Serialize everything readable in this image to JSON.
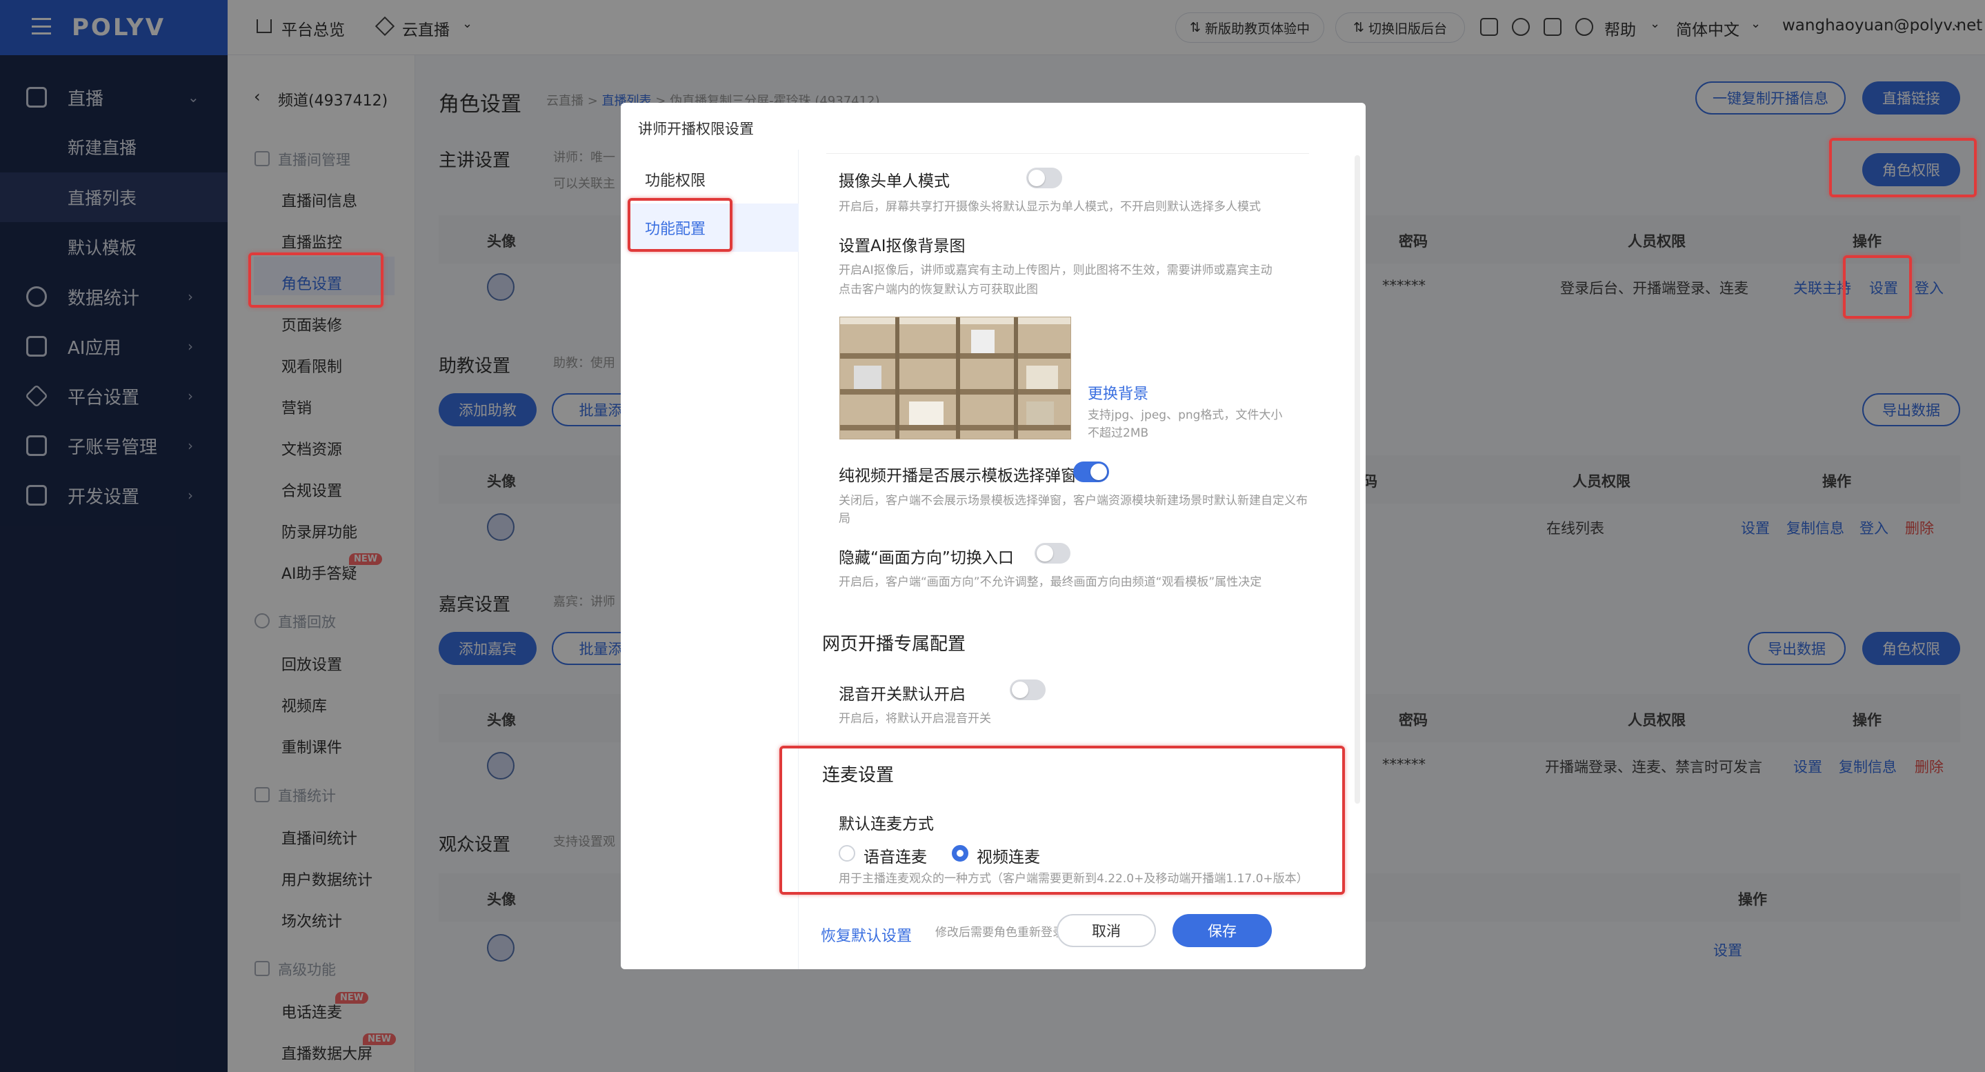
{
  "app": {
    "brand": "POLYV"
  },
  "nav": {
    "items": [
      {
        "label": "直播",
        "icon": "video-icon",
        "chevron": "⌄"
      },
      {
        "label": "新建直播"
      },
      {
        "label": "直播列表"
      },
      {
        "label": "默认模板"
      },
      {
        "label": "数据统计",
        "icon": "chart-icon",
        "chevron": "›"
      },
      {
        "label": "AI应用",
        "icon": "ai-icon",
        "chevron": "›"
      },
      {
        "label": "平台设置",
        "icon": "layers-icon",
        "chevron": "›"
      },
      {
        "label": "子账号管理",
        "icon": "id-card-icon",
        "chevron": "›"
      },
      {
        "label": "开发设置",
        "icon": "code-icon",
        "chevron": "›"
      }
    ]
  },
  "topbar": {
    "overview": "平台总览",
    "cloud_live": "云直播",
    "assistant_trial": "新版助教页体验中",
    "switch_old": "切换旧版后台",
    "help": "帮助",
    "language": "简体中文",
    "user": "wanghaoyuan@polyv.net"
  },
  "subnav": {
    "back_label": "频道(4937412)",
    "groups": [
      {
        "title": "直播间管理",
        "items": [
          "直播间信息",
          "直播监控",
          "角色设置",
          "页面装修",
          "观看限制",
          "营销",
          "文档资源",
          "合规设置",
          "防录屏功能",
          "AI助手答疑"
        ]
      },
      {
        "title": "直播回放",
        "items": [
          "回放设置",
          "视频库",
          "重制课件"
        ]
      },
      {
        "title": "直播统计",
        "items": [
          "直播间统计",
          "用户数据统计",
          "场次统计"
        ]
      },
      {
        "title": "高级功能",
        "items": [
          "电话连麦",
          "直播数据大屏"
        ]
      }
    ],
    "new_badge": "NEW"
  },
  "main": {
    "page_title": "角色设置",
    "breadcrumb": {
      "root": "云直播 >",
      "list": "直播列表",
      "sep": ">",
      "current": "伪直播复制三分屏-霍玲珠 (4937412)"
    },
    "copy_info_button": "一键复制开播信息",
    "live_link_button": "直播链接",
    "role_permission_button": "角色权限",
    "export_button": "导出数据",
    "lecturer": {
      "title": "主讲设置",
      "hint1": "讲师：唯一",
      "hint2": "可以关联主",
      "headers": [
        "头像",
        "密码",
        "人员权限",
        "操作"
      ],
      "row": {
        "password": "******",
        "permission": "登录后台、开播端登录、连麦",
        "actions": [
          "关联主持",
          "设置",
          "登入"
        ]
      }
    },
    "assistant": {
      "title": "助教设置",
      "hint": "助教：使用",
      "add_button": "添加助教",
      "batch_button": "批量添",
      "headers": [
        "头像",
        "码",
        "人员权限",
        "操作"
      ],
      "row": {
        "permission": "在线列表",
        "actions": [
          "设置",
          "复制信息",
          "登入",
          "删除"
        ]
      }
    },
    "guest": {
      "title": "嘉宾设置",
      "hint": "嘉宾：讲师",
      "add_button": "添加嘉宾",
      "batch_button": "批量添",
      "headers": [
        "头像",
        "密码",
        "人员权限",
        "操作"
      ],
      "row": {
        "password": "******",
        "permission": "开播端登录、连麦、禁言时可发言",
        "actions": [
          "设置",
          "复制信息",
          "删除"
        ]
      }
    },
    "audience": {
      "title": "观众设置",
      "hint": "支持设置观",
      "headers": [
        "头像",
        "操作"
      ],
      "row": {
        "actions": [
          "设置"
        ]
      }
    }
  },
  "modal": {
    "title": "讲师开播权限设置",
    "tabs": [
      "功能权限",
      "功能配置"
    ],
    "camera_single": {
      "label": "摄像头单人模式",
      "desc": "开启后，屏幕共享打开摄像头将默认显示为单人模式，不开启则默认选择多人模式",
      "on": false
    },
    "ai_bg": {
      "label": "设置AI抠像背景图",
      "desc1": "开启AI抠像后，讲师或嘉宾有主动上传图片，则此图将不生效，需要讲师或嘉宾主动",
      "desc2": "点击客户端内的恢复默认方可获取此图",
      "change": "更换背景",
      "tip1": "支持jpg、jpeg、png格式，文件大小",
      "tip2": "不超过2MB"
    },
    "pure_video": {
      "label": "纯视频开播是否展示模板选择弹窗",
      "desc1": "关闭后，客户端不会展示场景模板选择弹窗，客户端资源模块新建场景时默认新建自定义布",
      "desc2": "局",
      "on": true
    },
    "hide_orientation": {
      "label": "隐藏“画面方向”切换入口",
      "desc": "开启后，客户端“画面方向”不允许调整，最终画面方向由频道“观看模板”属性决定",
      "on": false
    },
    "web_section": "网页开播专属配置",
    "mix": {
      "label": "混音开关默认开启",
      "desc": "开启后，将默认开启混音开关",
      "on": false
    },
    "mic_section": "连麦设置",
    "mic_default": "默认连麦方式",
    "mic_options": [
      "语音连麦",
      "视频连麦"
    ],
    "mic_selected": "视频连麦",
    "mic_desc": "用于主播连麦观众的一种方式（客户端需要更新到4.22.0+及移动端开播端1.17.0+版本）",
    "restore": "恢复默认设置",
    "footer_note": "修改后需要角色重新登录才生效",
    "cancel": "取消",
    "save": "保存"
  },
  "colors": {
    "primary": "#3a6fe0",
    "nav_bg": "#1d2a4d",
    "highlight": "#e03a3a",
    "danger": "#e4514c"
  }
}
